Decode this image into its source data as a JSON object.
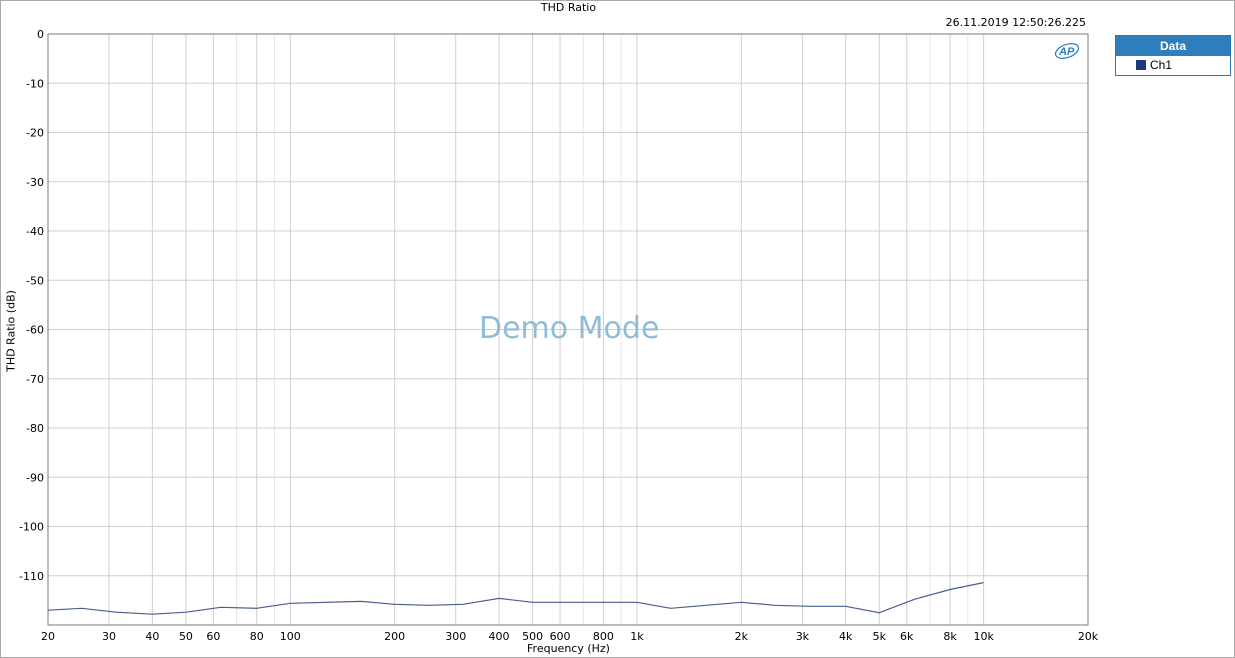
{
  "window": {
    "title": "THD Ratio",
    "timestamp": "26.11.2019 12:50:26.225",
    "watermark": "Demo Mode",
    "logo_text": "AP"
  },
  "legend": {
    "header": "Data",
    "items": [
      {
        "label": "Ch1",
        "color": "#1f3a7a"
      }
    ]
  },
  "chart_data": {
    "type": "line",
    "title": "THD Ratio",
    "xlabel": "Frequency (Hz)",
    "ylabel": "THD Ratio (dB)",
    "x_scale": "log",
    "xlim": [
      20,
      20000
    ],
    "ylim": [
      -120,
      0
    ],
    "grid": true,
    "legend_position": "right",
    "x_ticks": [
      {
        "value": 20,
        "label": "20"
      },
      {
        "value": 30,
        "label": "30"
      },
      {
        "value": 40,
        "label": "40"
      },
      {
        "value": 50,
        "label": "50"
      },
      {
        "value": 60,
        "label": "60"
      },
      {
        "value": 80,
        "label": "80"
      },
      {
        "value": 100,
        "label": "100"
      },
      {
        "value": 200,
        "label": "200"
      },
      {
        "value": 300,
        "label": "300"
      },
      {
        "value": 400,
        "label": "400"
      },
      {
        "value": 500,
        "label": "500"
      },
      {
        "value": 600,
        "label": "600"
      },
      {
        "value": 800,
        "label": "800"
      },
      {
        "value": 1000,
        "label": "1k"
      },
      {
        "value": 2000,
        "label": "2k"
      },
      {
        "value": 3000,
        "label": "3k"
      },
      {
        "value": 4000,
        "label": "4k"
      },
      {
        "value": 5000,
        "label": "5k"
      },
      {
        "value": 6000,
        "label": "6k"
      },
      {
        "value": 8000,
        "label": "8k"
      },
      {
        "value": 10000,
        "label": "10k"
      },
      {
        "value": 20000,
        "label": "20k"
      }
    ],
    "y_ticks": [
      {
        "value": 0,
        "label": "0"
      },
      {
        "value": -10,
        "label": "-10"
      },
      {
        "value": -20,
        "label": "-20"
      },
      {
        "value": -30,
        "label": "-30"
      },
      {
        "value": -40,
        "label": "-40"
      },
      {
        "value": -50,
        "label": "-50"
      },
      {
        "value": -60,
        "label": "-60"
      },
      {
        "value": -70,
        "label": "-70"
      },
      {
        "value": -80,
        "label": "-80"
      },
      {
        "value": -90,
        "label": "-90"
      },
      {
        "value": -100,
        "label": "-100"
      },
      {
        "value": -110,
        "label": "-110"
      }
    ],
    "series": [
      {
        "name": "Ch1",
        "color": "#4a5f8f",
        "x": [
          20,
          25,
          31.5,
          40,
          50,
          63,
          80,
          100,
          160,
          200,
          250,
          315,
          400,
          500,
          630,
          800,
          1000,
          1250,
          2000,
          2500,
          3150,
          4000,
          5000,
          6300,
          8000,
          10000
        ],
        "y": [
          -117.0,
          -116.6,
          -117.4,
          -117.8,
          -117.4,
          -116.4,
          -116.6,
          -115.6,
          -115.2,
          -115.8,
          -116.0,
          -115.8,
          -114.6,
          -115.4,
          -115.4,
          -115.4,
          -115.4,
          -116.6,
          -115.4,
          -116.0,
          -116.2,
          -116.2,
          -117.5,
          -114.8,
          -112.8,
          -111.4
        ]
      }
    ]
  }
}
